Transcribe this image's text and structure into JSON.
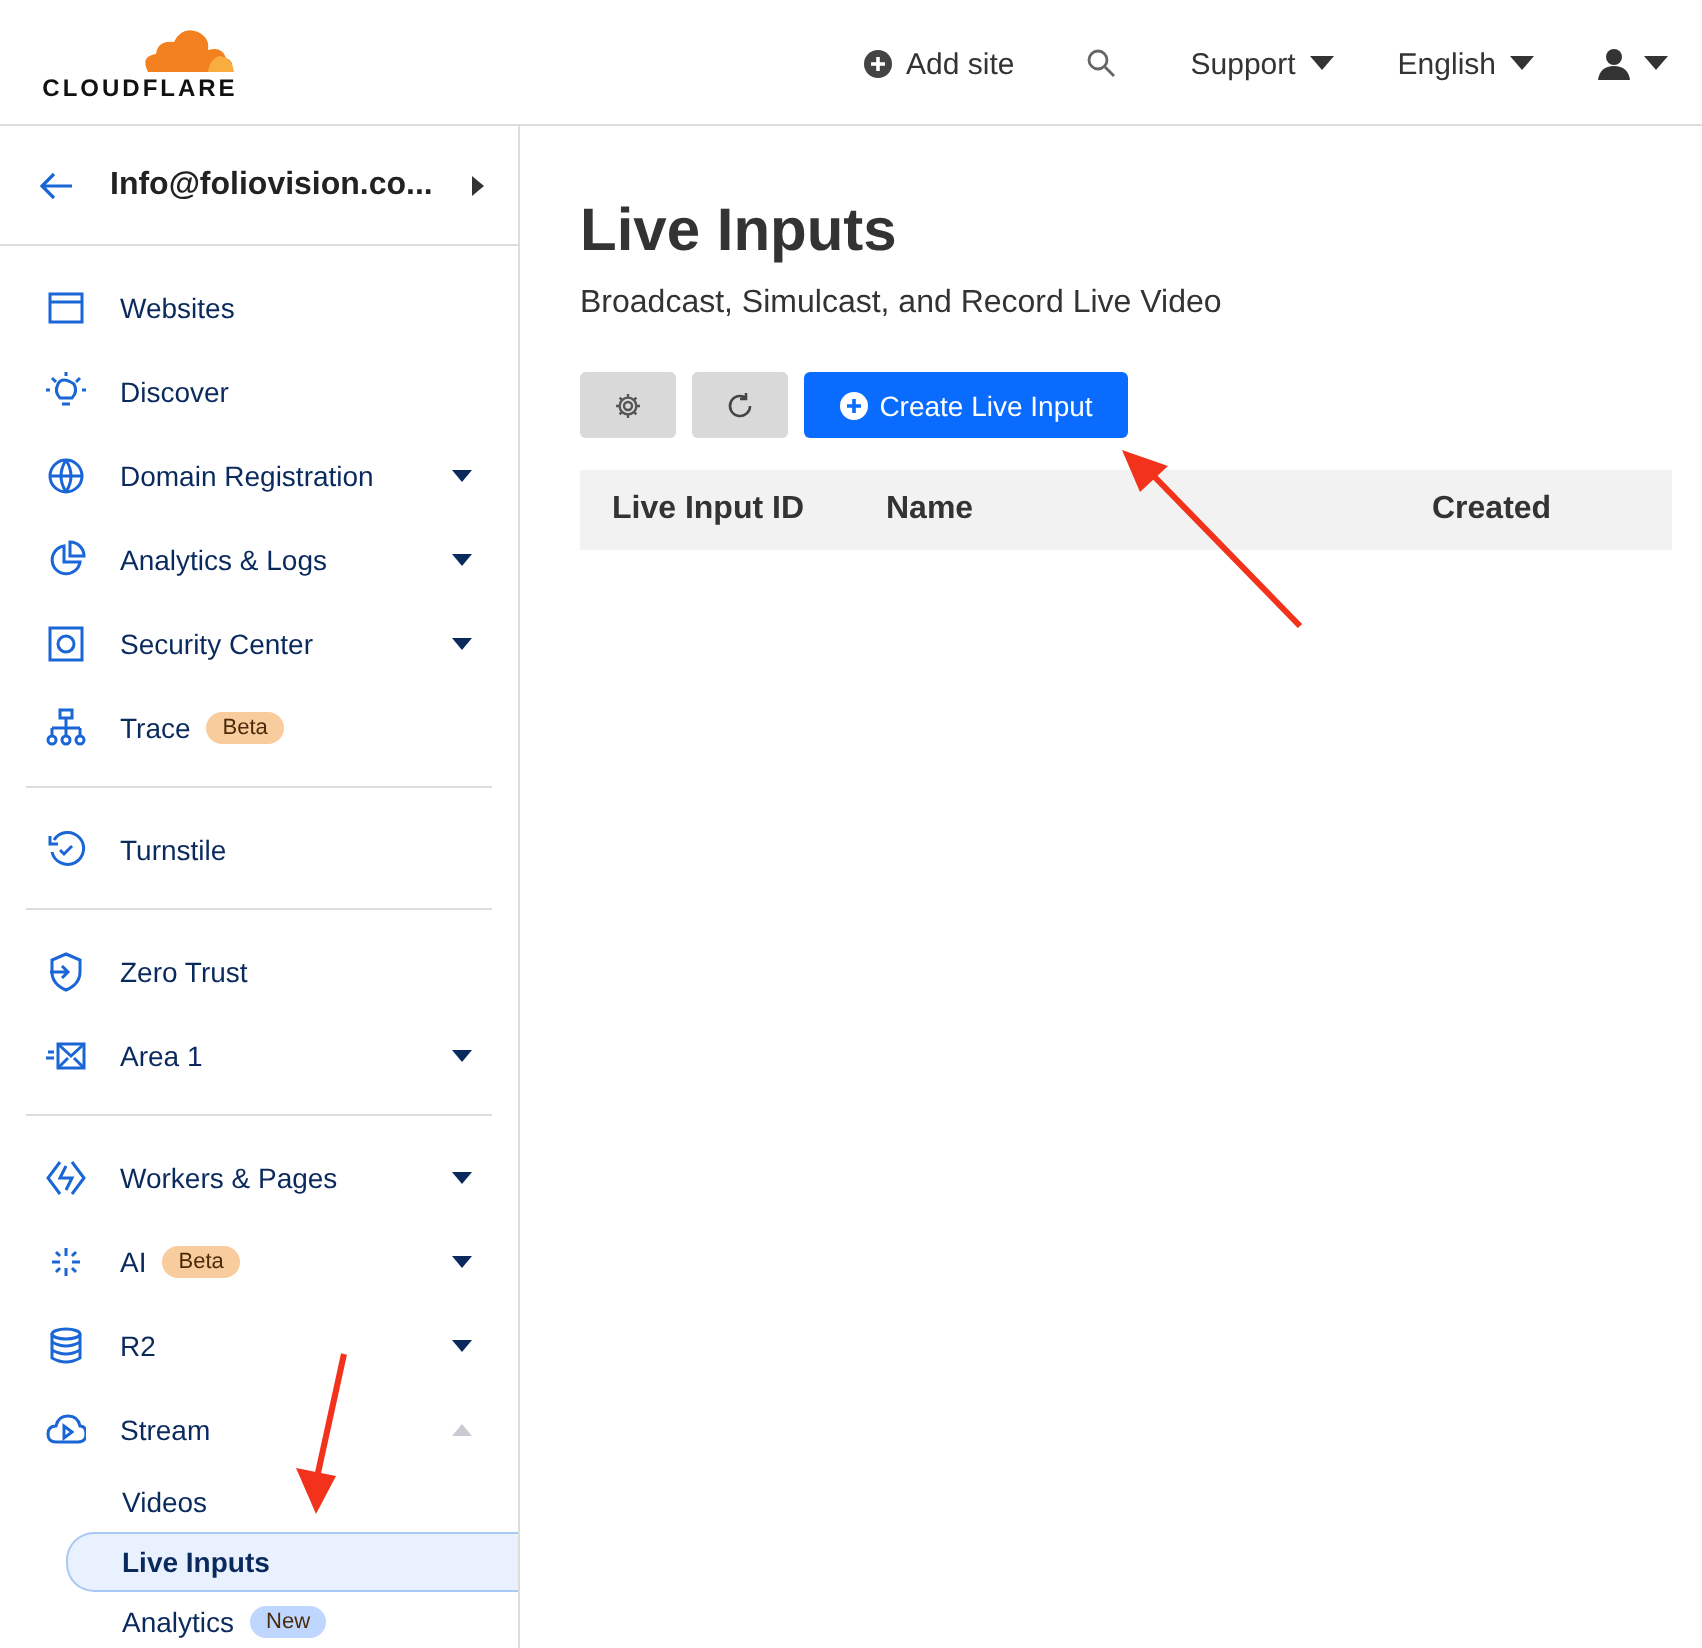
{
  "header": {
    "logo_text": "CLOUDFLARE",
    "add_site": "Add site",
    "support": "Support",
    "language": "English"
  },
  "sidebar": {
    "account": "Info@foliovision.co...",
    "groups": [
      [
        {
          "label": "Websites",
          "has_menu": false
        },
        {
          "label": "Discover",
          "has_menu": false
        },
        {
          "label": "Domain Registration",
          "has_menu": true,
          "expanded": false
        },
        {
          "label": "Analytics & Logs",
          "has_menu": true,
          "expanded": false
        },
        {
          "label": "Security Center",
          "has_menu": true,
          "expanded": false
        },
        {
          "label": "Trace",
          "has_menu": false,
          "badge": {
            "text": "Beta",
            "color": "#f9cc9d"
          }
        }
      ],
      [
        {
          "label": "Turnstile",
          "has_menu": false
        }
      ],
      [
        {
          "label": "Zero Trust",
          "has_menu": false
        },
        {
          "label": "Area 1",
          "has_menu": true,
          "expanded": false
        }
      ],
      [
        {
          "label": "Workers & Pages",
          "has_menu": true,
          "expanded": false
        },
        {
          "label": "AI",
          "has_menu": true,
          "expanded": false,
          "badge": {
            "text": "Beta",
            "color": "#f9cc9d"
          }
        },
        {
          "label": "R2",
          "has_menu": true,
          "expanded": false
        },
        {
          "label": "Stream",
          "has_menu": true,
          "expanded": true,
          "children": [
            {
              "label": "Videos",
              "selected": false
            },
            {
              "label": "Live Inputs",
              "selected": true
            },
            {
              "label": "Analytics",
              "selected": false,
              "badge": {
                "text": "New",
                "color": "#bfd7ff"
              }
            }
          ]
        }
      ]
    ]
  },
  "main": {
    "title": "Live Inputs",
    "subtitle": "Broadcast, Simulcast, and Record Live Video",
    "create_button": {
      "label": "Create Live Input"
    },
    "table": {
      "columns": [
        "Live Input ID",
        "Name",
        "Created"
      ]
    }
  },
  "annotations": [
    {
      "kind": "arrow"
    },
    {
      "kind": "arrow"
    }
  ]
}
